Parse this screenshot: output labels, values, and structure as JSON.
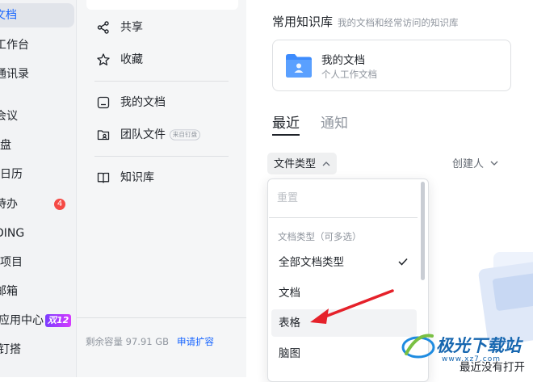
{
  "left_nav": {
    "items": [
      {
        "label": "文档",
        "active": true
      },
      {
        "label": "工作台"
      },
      {
        "label": "通讯录"
      },
      {
        "label": "会议"
      },
      {
        "label": "盘"
      },
      {
        "label": "日历"
      },
      {
        "label": "待办",
        "badge": "4"
      },
      {
        "label": "DING"
      },
      {
        "label": "项目"
      },
      {
        "label": "邮箱"
      },
      {
        "label": "应用中心",
        "promo": "双12"
      },
      {
        "label": "钉搭"
      }
    ]
  },
  "sub_nav": {
    "items": [
      {
        "label": "共享",
        "icon": "share-icon"
      },
      {
        "label": "收藏",
        "icon": "star-icon"
      },
      {
        "label": "我的文档",
        "icon": "my-docs-icon"
      },
      {
        "label": "团队文件",
        "icon": "team-files-icon",
        "tag": "来自钉盘"
      },
      {
        "label": "知识库",
        "icon": "book-icon"
      }
    ],
    "storage_text": "剩余容量 97.91 GB",
    "expand_link": "申请扩容"
  },
  "main": {
    "section_title": "常用知识库",
    "section_subtitle": "我的文档和经常访问的知识库",
    "kb_card": {
      "name": "我的文档",
      "desc": "个人工作文档"
    },
    "tabs": [
      {
        "label": "最近",
        "active": true
      },
      {
        "label": "通知"
      }
    ],
    "filter_label": "文件类型",
    "creator_label": "创建人",
    "empty_text": "最近没有打开"
  },
  "dropdown": {
    "reset": "重置",
    "group_label": "文档类型（可多选）",
    "options": [
      {
        "label": "全部文档类型",
        "checked": true
      },
      {
        "label": "文档"
      },
      {
        "label": "表格",
        "hover": true
      },
      {
        "label": "脑图"
      }
    ]
  },
  "watermark": {
    "title": "极光下载站",
    "url": "www.xz7.com"
  },
  "colors": {
    "accent": "#1664ff",
    "badge": "#f54a45",
    "annotation_arrow": "#e5212a"
  }
}
